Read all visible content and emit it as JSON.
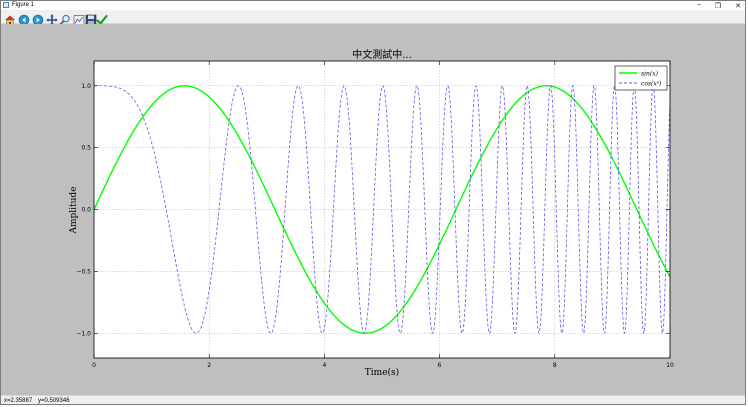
{
  "window": {
    "title": "Figure 1",
    "min_glyph": "−",
    "max_glyph": "❐",
    "close_glyph": "✕"
  },
  "toolbar": {
    "buttons": [
      {
        "name": "home-icon"
      },
      {
        "name": "back-icon"
      },
      {
        "name": "forward-icon"
      },
      {
        "name": "pan-icon"
      },
      {
        "name": "zoom-icon"
      },
      {
        "name": "configure-subplots-icon"
      },
      {
        "name": "save-icon"
      },
      {
        "name": "edit-checkmark-icon"
      }
    ]
  },
  "colors": {
    "sin": "#00ff00",
    "cos": "#5a5ae6",
    "axes_bg": "#ffffff",
    "figure_bg": "#bfbfbf"
  },
  "chart_data": {
    "type": "line",
    "title": "中文測試中...",
    "xlabel": "Time(s)",
    "ylabel": "Amplitude",
    "xlim": [
      0,
      10
    ],
    "ylim": [
      -1.2,
      1.2
    ],
    "grid": true,
    "legend_position": "top-right",
    "xticks": [
      "0",
      "2",
      "4",
      "6",
      "8",
      "10"
    ],
    "yticks": [
      "1.0",
      "0.5",
      "0.0",
      "−0.5",
      "−1.0"
    ],
    "series": [
      {
        "name": "sin(x)",
        "function": "sin(x)",
        "style": "solid",
        "color": "#00ff00",
        "x_range": [
          0,
          10
        ]
      },
      {
        "name": "cos(x²)",
        "function": "cos(x^2)",
        "style": "dashed",
        "color": "#5a5ae6",
        "x_range": [
          0,
          10
        ]
      }
    ]
  },
  "status": {
    "x_readout": "x=2.35887",
    "y_readout": "y=0.509346"
  }
}
